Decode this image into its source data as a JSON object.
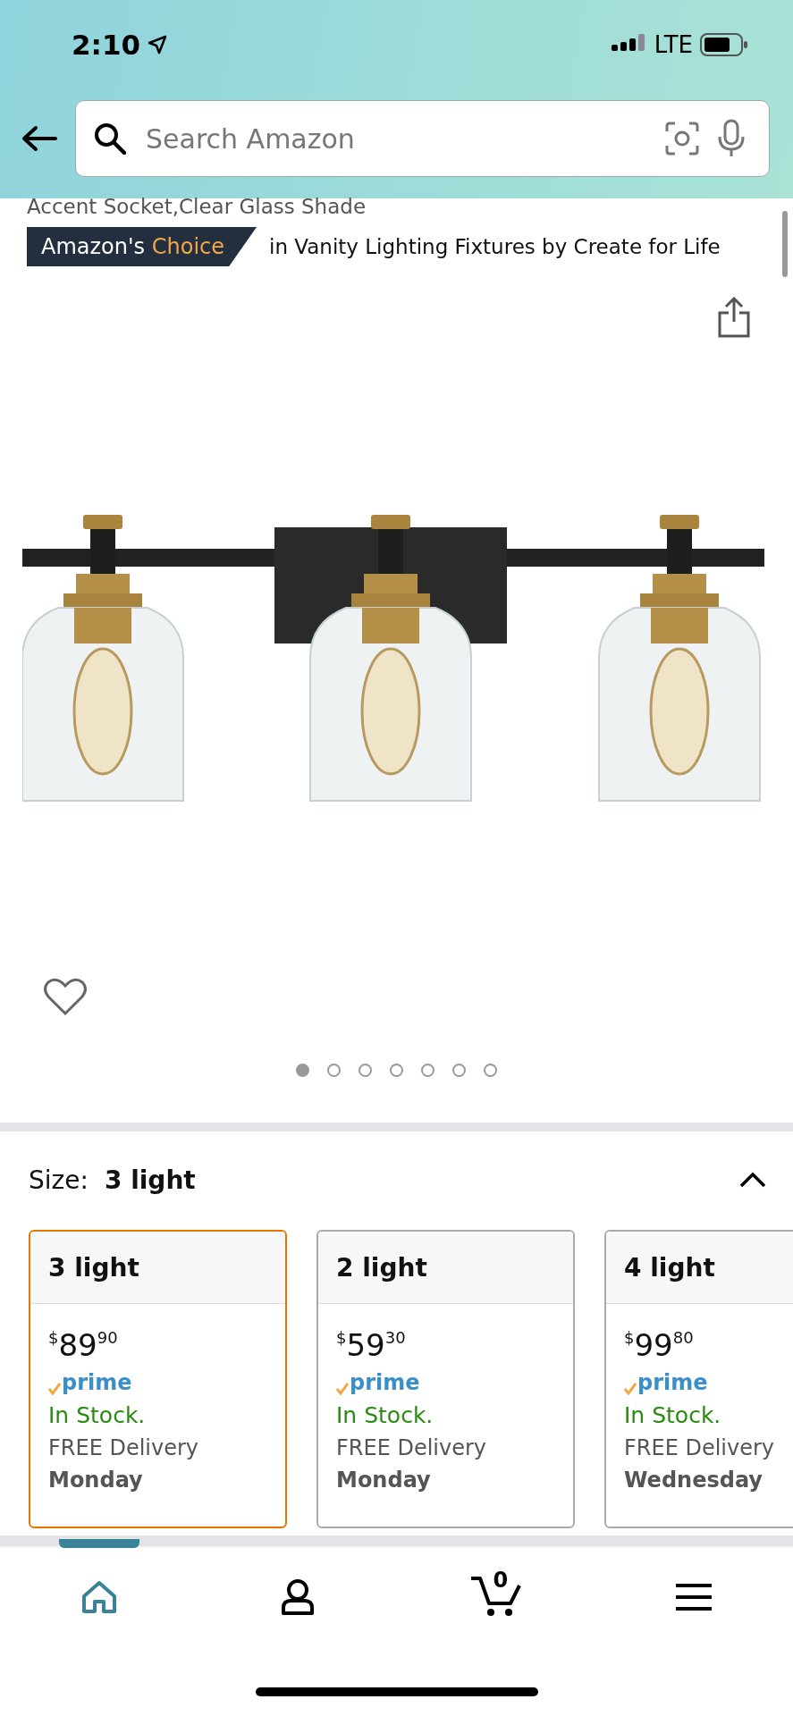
{
  "status_bar": {
    "time": "2:10",
    "network": "LTE"
  },
  "search": {
    "placeholder": "Search Amazon"
  },
  "product": {
    "subtitle": "Accent Socket,Clear Glass Shade",
    "badge": {
      "prefix": "Amazon's",
      "highlight": "Choice"
    },
    "badge_context": "in Vanity Lighting Fixtures by Create for Life",
    "favorited": false
  },
  "gallery_dots": [
    {
      "selected": true
    },
    {
      "selected": false
    },
    {
      "selected": false
    },
    {
      "selected": false
    },
    {
      "selected": false
    },
    {
      "selected": false
    },
    {
      "selected": false
    }
  ],
  "size": {
    "label": "Size:",
    "value": "3 light",
    "expanded": true
  },
  "options": [
    {
      "name": "3 light",
      "currency": "$",
      "dollars": "89",
      "cents": "90",
      "prime": "prime",
      "stock": "In Stock.",
      "delivery": "FREE Delivery",
      "day": "Monday",
      "selected": true
    },
    {
      "name": "2 light",
      "currency": "$",
      "dollars": "59",
      "cents": "30",
      "prime": "prime",
      "stock": "In Stock.",
      "delivery": "FREE Delivery",
      "day": "Monday",
      "selected": false
    },
    {
      "name": "4 light",
      "currency": "$",
      "dollars": "99",
      "cents": "80",
      "prime": "prime",
      "stock": "In Stock.",
      "delivery": "FREE Delivery",
      "day": "Wednesday",
      "selected": false
    }
  ],
  "nav": [
    {
      "kind": "home",
      "selected": true
    },
    {
      "kind": "account",
      "selected": false
    },
    {
      "kind": "cart",
      "count": "0",
      "selected": false
    },
    {
      "kind": "menu",
      "selected": false
    }
  ]
}
